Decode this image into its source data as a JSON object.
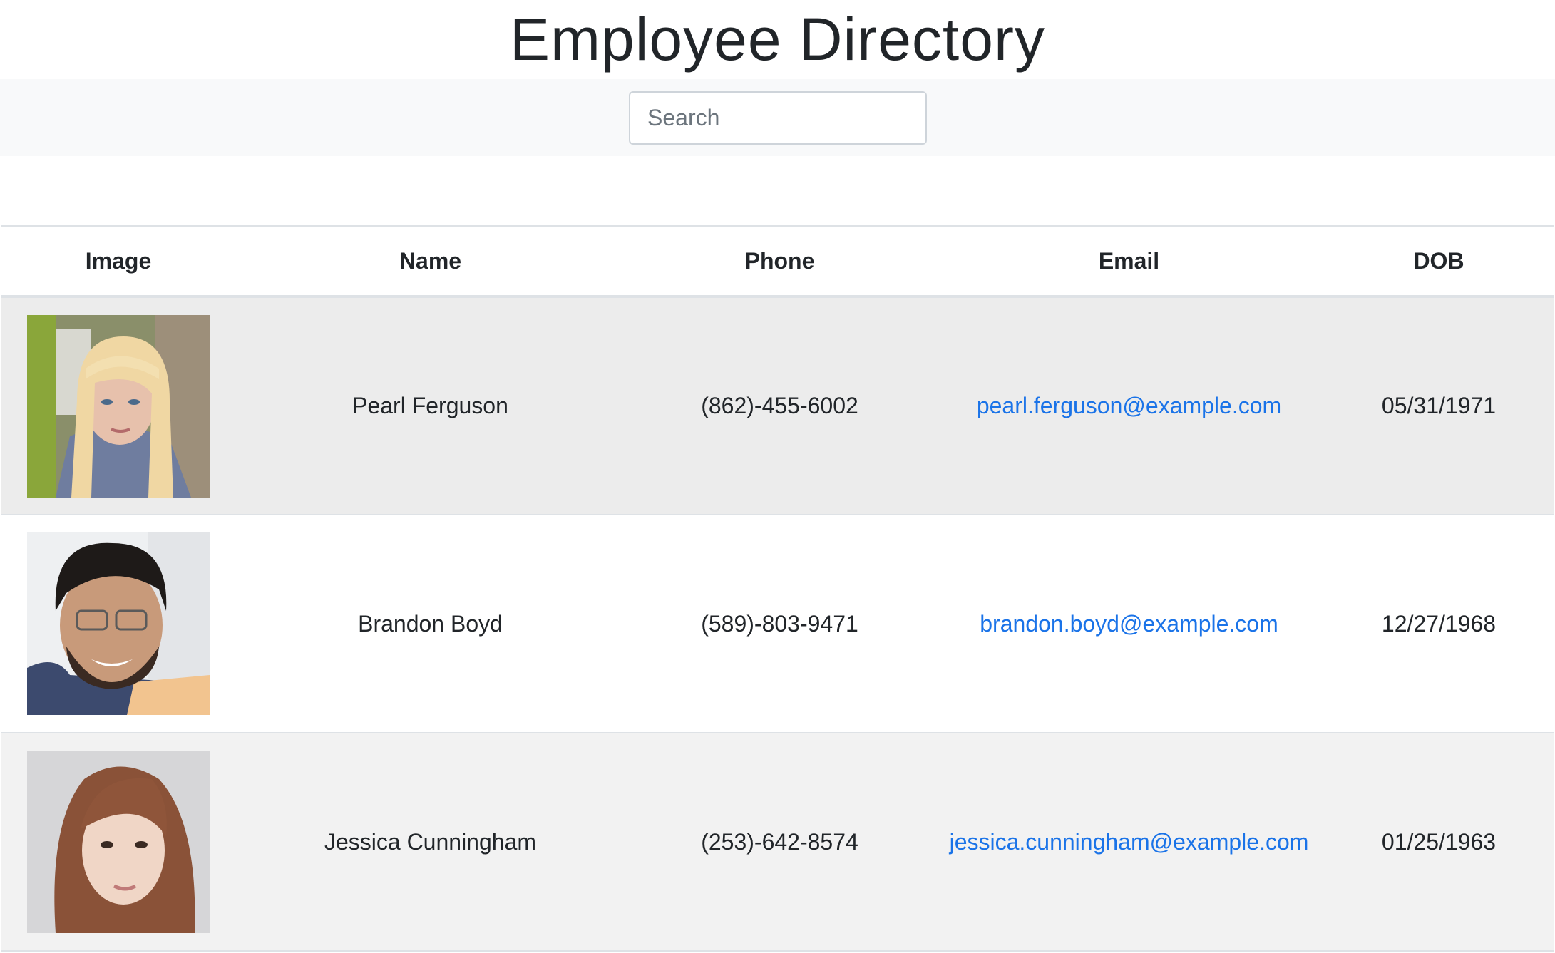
{
  "page": {
    "title": "Employee Directory"
  },
  "search": {
    "placeholder": "Search",
    "value": ""
  },
  "table": {
    "headers": {
      "image": "Image",
      "name": "Name",
      "phone": "Phone",
      "email": "Email",
      "dob": "DOB"
    },
    "rows": [
      {
        "name": "Pearl Ferguson",
        "phone": "(862)-455-6002",
        "email": "pearl.ferguson@example.com",
        "dob": "05/31/1971"
      },
      {
        "name": "Brandon Boyd",
        "phone": "(589)-803-9471",
        "email": "brandon.boyd@example.com",
        "dob": "12/27/1968"
      },
      {
        "name": "Jessica Cunningham",
        "phone": "(253)-642-8574",
        "email": "jessica.cunningham@example.com",
        "dob": "01/25/1963"
      }
    ]
  },
  "colors": {
    "link": "#1a73e8",
    "text": "#212529",
    "search_band": "#f8f9fa",
    "row_odd": "#ececec",
    "row_alt": "#f2f2f2"
  }
}
